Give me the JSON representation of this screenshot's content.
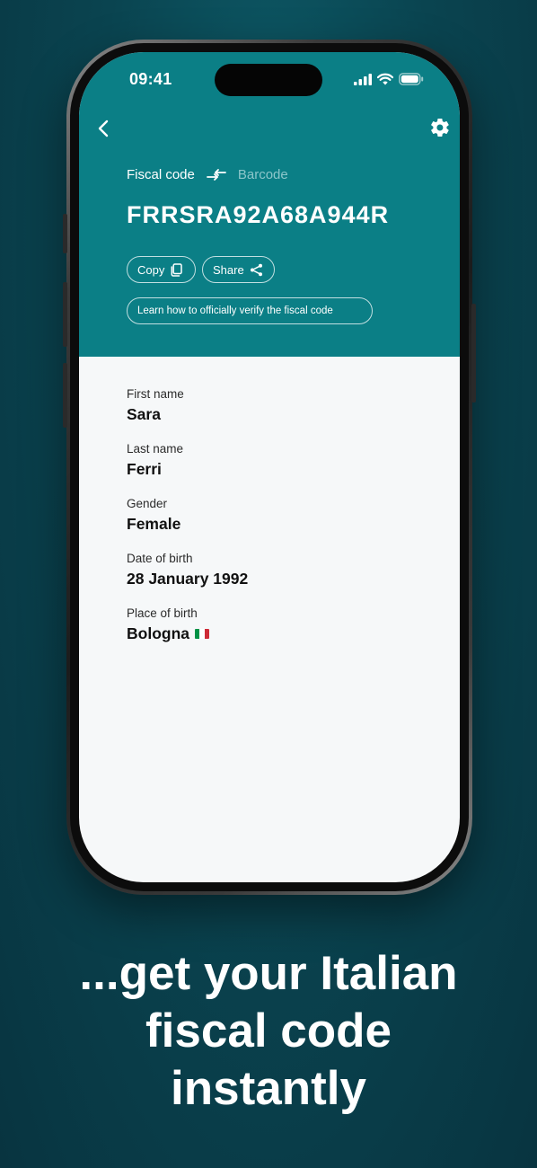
{
  "status_bar": {
    "time": "09:41"
  },
  "header": {
    "back_icon": "chevron-left-icon",
    "settings_icon": "gear-icon",
    "switcher": {
      "active_label": "Fiscal code",
      "swap_icon": "swap-arrows-icon",
      "inactive_label": "Barcode"
    },
    "fiscal_code": "FRRSRA92A68A944R",
    "actions": {
      "copy_label": "Copy",
      "copy_icon": "copy-icon",
      "share_label": "Share",
      "share_icon": "share-icon",
      "verify_label": "Learn how to officially verify the fiscal code"
    }
  },
  "details": {
    "fields": [
      {
        "label": "First name",
        "value": "Sara"
      },
      {
        "label": "Last name",
        "value": "Ferri"
      },
      {
        "label": "Gender",
        "value": "Female"
      },
      {
        "label": "Date of birth",
        "value": "28 January 1992"
      },
      {
        "label": "Place of birth",
        "value": "Bologna",
        "icon": "italy-flag-icon"
      }
    ]
  },
  "caption": {
    "line1": "...get your Italian",
    "line2": "fiscal code",
    "line3": "instantly"
  },
  "colors": {
    "header_bg": "#0b7f86",
    "page_bg": "#0a4450",
    "screen_bg": "#f6f8f9",
    "flag_green": "#009246",
    "flag_white": "#ffffff",
    "flag_red": "#ce2b37"
  }
}
